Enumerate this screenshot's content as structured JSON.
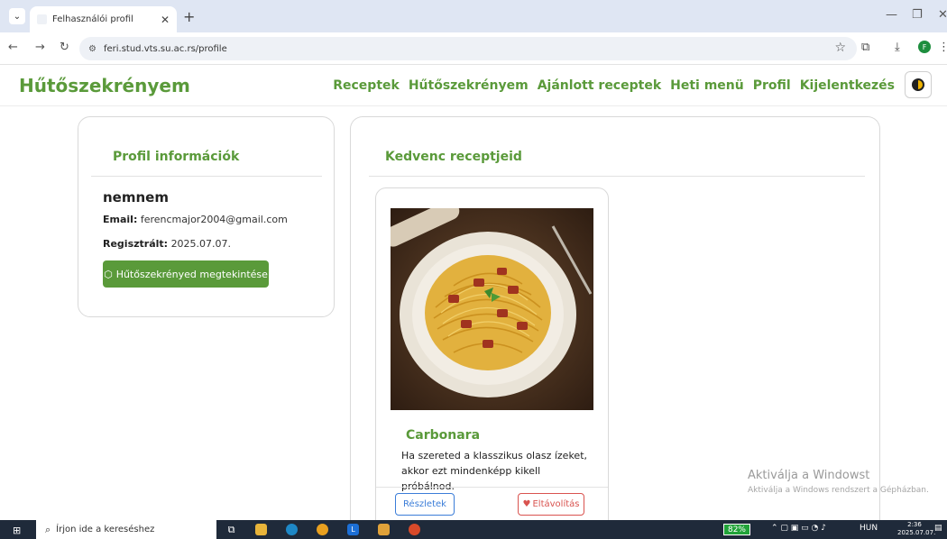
{
  "browser": {
    "tab_title": "Felhasználói profil",
    "url": "feri.stud.vts.su.ac.rs/profile",
    "profile_initial": "F"
  },
  "site": {
    "brand": "Hűtőszekrényem",
    "nav": [
      "Receptek",
      "Hűtőszekrényem",
      "Ajánlott receptek",
      "Heti menü",
      "Profil",
      "Kijelentkezés"
    ]
  },
  "profile": {
    "heading": "Profil információk",
    "username": "nemnem",
    "email_label": "Email:",
    "email": "ferencmajor2004@gmail.com",
    "registered_label": "Regisztrált:",
    "registered": "2025.07.07.",
    "fridge_button": "Hűtőszekrényed megtekintése"
  },
  "favorites": {
    "heading": "Kedvenc receptjeid",
    "recipes": [
      {
        "name": "Carbonara",
        "description": "Ha szereted a klasszikus olasz ízeket, akkor ezt mindenképp kikell próbálnod.",
        "details_button": "Részletek",
        "remove_button": "Eltávolítás"
      }
    ]
  },
  "watermark": {
    "title": "Aktiválja a Windowst",
    "subtitle": "Aktiválja a Windows rendszert a Gépházban."
  },
  "taskbar": {
    "search_placeholder": "Írjon ide a kereséshez",
    "battery": "82%",
    "language": "HUN",
    "time": "2:36",
    "date": "2025.07.07."
  },
  "colors": {
    "brand_green": "#5a9a3a",
    "primary_blue": "#3b7dd8",
    "danger_red": "#d9534f"
  }
}
